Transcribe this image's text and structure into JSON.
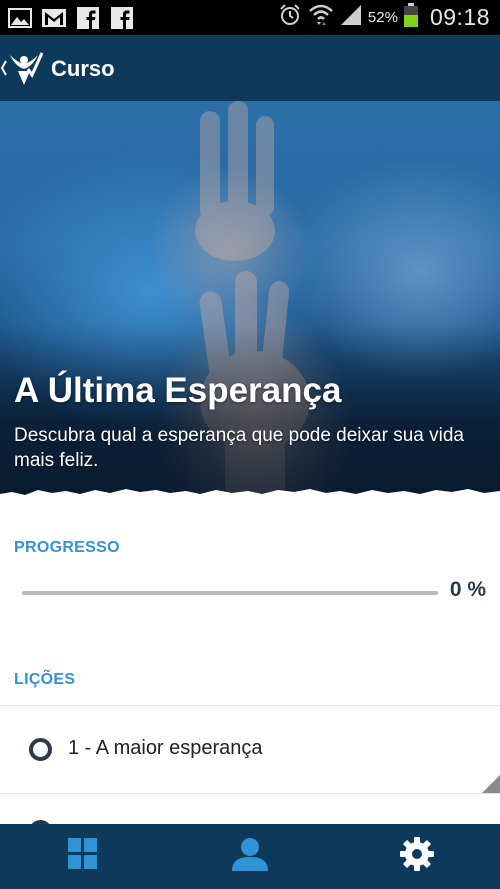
{
  "statusbar": {
    "battery_text": "52%",
    "time": "09:18",
    "icons": [
      "image-icon",
      "gmail-icon",
      "facebook-icon",
      "facebook-icon",
      "alarm-icon",
      "wifi-icon",
      "signal-icon",
      "battery-icon"
    ]
  },
  "appbar": {
    "title": "Curso"
  },
  "course": {
    "title": "A Última Esperança",
    "subtitle": "Descubra qual a esperança que pode deixar sua vida mais feliz."
  },
  "progress": {
    "label": "PROGRESSO",
    "percent": 0,
    "value_text": "0 %"
  },
  "lessons": {
    "label": "LIÇÕES",
    "items": [
      {
        "label": "1 - A maior esperança"
      }
    ]
  },
  "bottomnav": {
    "items": [
      "grid-icon",
      "profile-icon",
      "settings-icon"
    ]
  },
  "colors": {
    "appbar": "#0d3a5a",
    "accent": "#2f93d6",
    "text_dark": "#2a3a4a"
  }
}
